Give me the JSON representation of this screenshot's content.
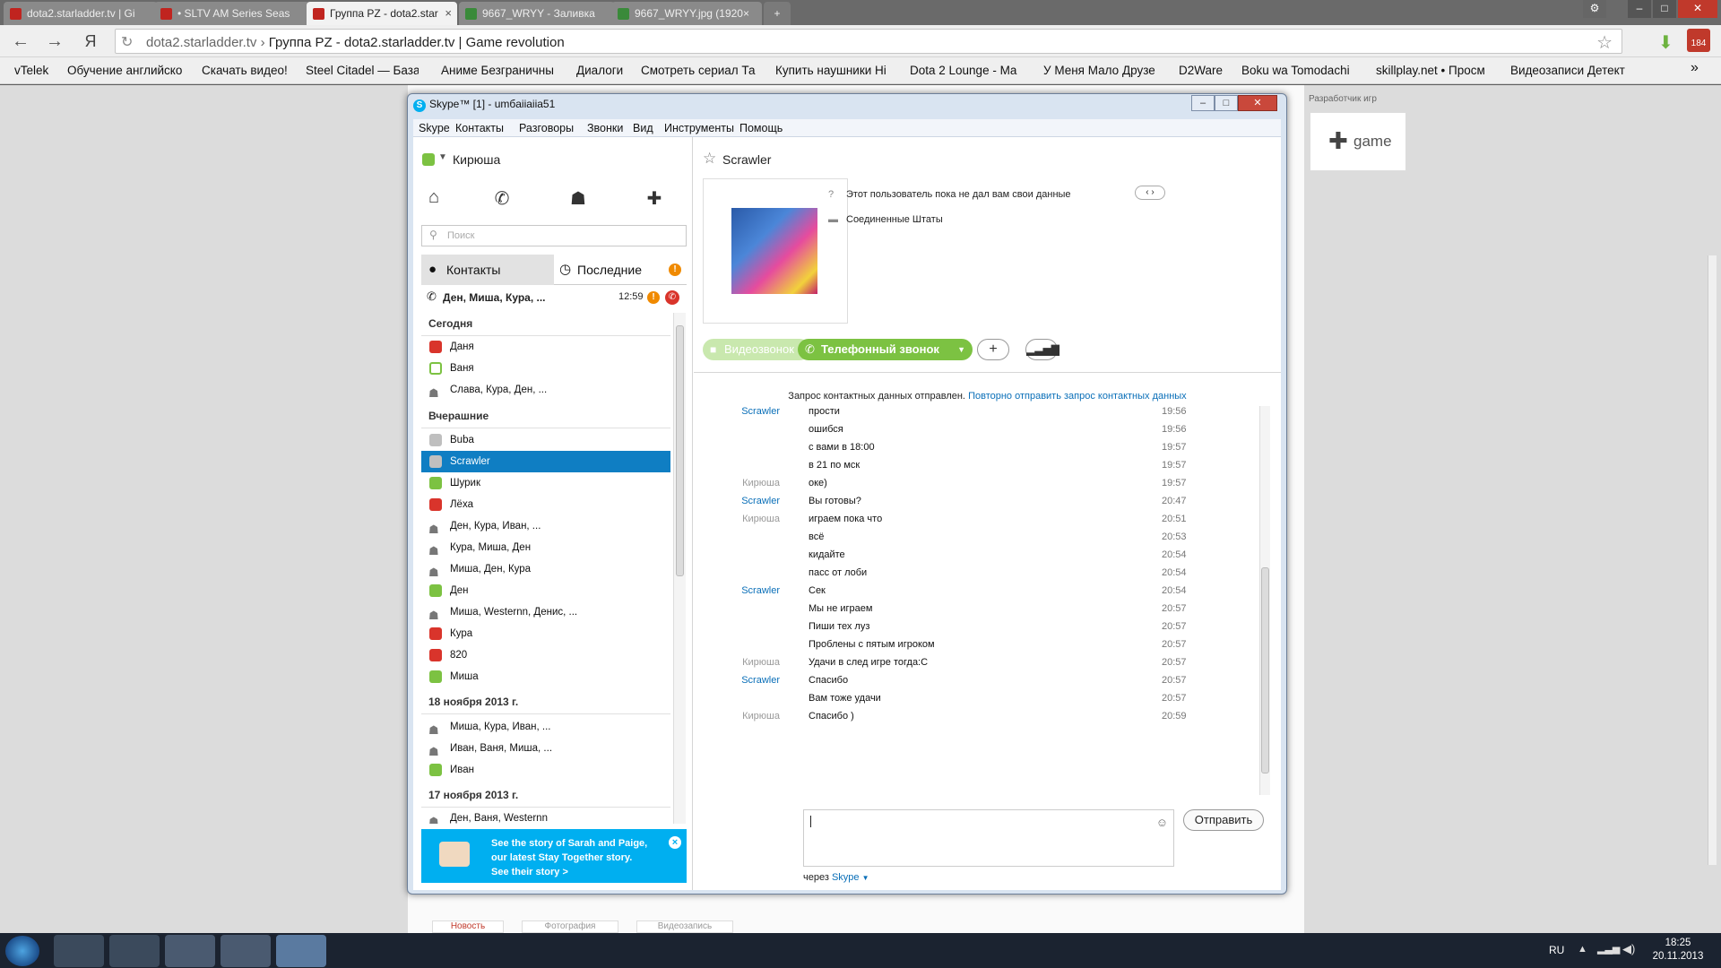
{
  "browser": {
    "tabs": [
      {
        "label": "dota2.starladder.tv | Gi"
      },
      {
        "label": "• SLTV AM Series Seas"
      },
      {
        "label": "Группа PZ - dota2.star"
      },
      {
        "label": "9667_WRYY - Заливка"
      },
      {
        "label": "9667_WRYY.jpg (1920×"
      }
    ],
    "address_domain": "dota2.starladder.tv",
    "address_title": "Группа PZ - dota2.starladder.tv | Game revolution",
    "bookmarks": [
      "vTelek",
      "Обучение английско",
      "Скачать видео!",
      "Steel Citadel — База",
      "Аниме Безграничны",
      "Диалоги",
      "Смотреть сериал Та",
      "Купить наушники Hi",
      "Dota 2 Lounge - Ma",
      "У Меня Мало Друзе",
      "D2Ware",
      "Boku wa Tomodachi",
      "skillplay.net • Просм",
      "Видеозаписи Детект"
    ],
    "extension_badge": "184"
  },
  "page": {
    "dev_label": "Разработчик игр",
    "dev_card": "game",
    "bottom_tabs": [
      "Новость",
      "Фотография",
      "Видеозапись"
    ]
  },
  "skype": {
    "title": "Skype™ [1] - umбaiiaiia51",
    "menu": [
      "Skype",
      "Контакты",
      "Разговоры",
      "Звонки",
      "Вид",
      "Инструменты",
      "Помощь"
    ],
    "me_name": "Кирюша",
    "search_placeholder": "Поиск",
    "tab_contacts": "Контакты",
    "tab_recent": "Последние",
    "tab_recent_badge": "!",
    "active_call": {
      "name": "Ден, Миша, Кура, ...",
      "time": "12:59"
    },
    "sections": [
      {
        "title": "Сегодня",
        "items": [
          {
            "name": "Даня",
            "status": "red"
          },
          {
            "name": "Ваня",
            "status": "ring"
          },
          {
            "name": "Слава, Кура, Ден, ...",
            "status": "group"
          }
        ]
      },
      {
        "title": "Вчерашние",
        "items": [
          {
            "name": "Buba",
            "status": "grey"
          },
          {
            "name": "Scrawler",
            "status": "grey",
            "selected": true
          },
          {
            "name": "Шурик",
            "status": "green"
          },
          {
            "name": "Лёха",
            "status": "red"
          },
          {
            "name": "Ден, Кура, Иван, ...",
            "status": "group"
          },
          {
            "name": "Кура, Миша, Ден",
            "status": "group"
          },
          {
            "name": "Миша, Ден, Кура",
            "status": "group"
          },
          {
            "name": "Ден",
            "status": "green"
          },
          {
            "name": "Миша, Westernn, Денис, ...",
            "status": "group"
          },
          {
            "name": "Кура",
            "status": "red"
          },
          {
            "name": "820",
            "status": "red"
          },
          {
            "name": "Миша",
            "status": "green"
          }
        ]
      },
      {
        "title": "18 ноября 2013 г.",
        "items": [
          {
            "name": "Миша, Кура, Иван, ...",
            "status": "group"
          },
          {
            "name": "Иван, Ваня, Миша, ...",
            "status": "group"
          },
          {
            "name": "Иван",
            "status": "green"
          }
        ]
      },
      {
        "title": "17 ноября 2013 г.",
        "items": [
          {
            "name": "Ден, Ваня, Westernn",
            "status": "group"
          }
        ]
      }
    ],
    "promo": {
      "line1": "See the story of Sarah and Paige,",
      "line2": "our latest Stay Together story.",
      "line3": "See their story >"
    },
    "contact": {
      "name": "Scrawler",
      "info_mood": "Этот пользователь пока не дал вам свои данные",
      "info_country": "Соединенные Штаты",
      "video_call": "Видеозвонок",
      "phone_call": "Телефонный звонок"
    },
    "request_text": "Запрос контактных данных отправлен.",
    "request_link": "Повторно отправить запрос контактных данных",
    "messages": [
      {
        "who": "Scrawler",
        "text": "прости",
        "time": "19:56"
      },
      {
        "who": "",
        "text": "ошибся",
        "time": "19:56"
      },
      {
        "who": "",
        "text": "с вами в 18:00",
        "time": "19:57"
      },
      {
        "who": "",
        "text": "в 21 по мск",
        "time": "19:57"
      },
      {
        "who": "Кирюша",
        "text": "оке)",
        "time": "19:57"
      },
      {
        "who": "Scrawler",
        "text": "Вы готовы?",
        "time": "20:47"
      },
      {
        "who": "Кирюша",
        "text": "играем пока что",
        "time": "20:51"
      },
      {
        "who": "",
        "text": "всё",
        "time": "20:53"
      },
      {
        "who": "",
        "text": "кидайте",
        "time": "20:54"
      },
      {
        "who": "",
        "text": "пасс от лоби",
        "time": "20:54"
      },
      {
        "who": "Scrawler",
        "text": "Сек",
        "time": "20:54"
      },
      {
        "who": "",
        "text": "Мы не играем",
        "time": "20:57"
      },
      {
        "who": "",
        "text": "Пиши тех луз",
        "time": "20:57"
      },
      {
        "who": "",
        "text": "Проблены с пятым игроком",
        "time": "20:57"
      },
      {
        "who": "Кирюша",
        "text": " Удачи в след игре тогда:С",
        "time": "20:57"
      },
      {
        "who": "Scrawler",
        "text": "Спасибо",
        "time": "20:57"
      },
      {
        "who": "",
        "text": "Вам тоже удачи",
        "time": "20:57"
      },
      {
        "who": "Кирюша",
        "text": "Спасибо )",
        "time": "20:59"
      }
    ],
    "send_label": "Отправить",
    "via_label": "через",
    "via_link": "Skype"
  },
  "taskbar": {
    "lang": "RU",
    "time": "18:25",
    "date": "20.11.2013"
  }
}
